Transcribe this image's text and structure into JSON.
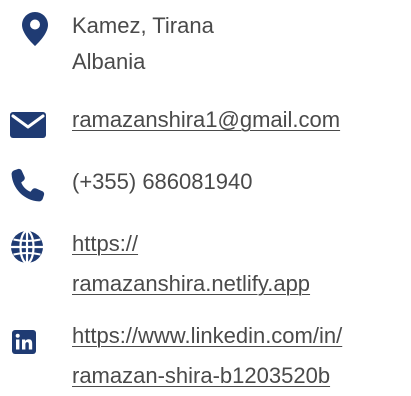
{
  "contact": {
    "location": {
      "icon": "map-pin-icon",
      "line1": "Kamez, Tirana",
      "line2": "Albania"
    },
    "email": {
      "icon": "envelope-icon",
      "text": "ramazanshira1@gmail.com"
    },
    "phone": {
      "icon": "phone-icon",
      "text": "(+355) 686081940"
    },
    "website": {
      "icon": "globe-icon",
      "line1": "https://",
      "line2": "ramazanshira.netlify.app"
    },
    "linkedin": {
      "icon": "linkedin-icon",
      "line1": "https://www.linkedin.com/in/",
      "line2": "ramazan-shira-b1203520b"
    }
  },
  "colors": {
    "icon": "#1f3b73",
    "text": "#4a4a4a"
  }
}
